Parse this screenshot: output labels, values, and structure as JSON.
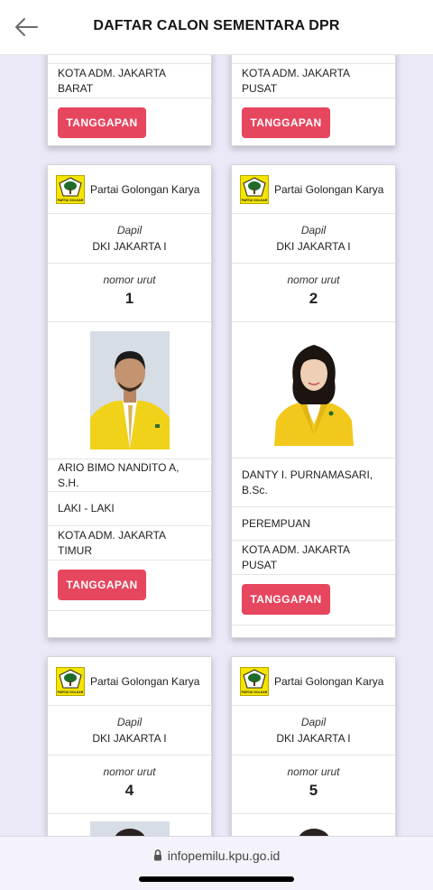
{
  "header": {
    "title": "DAFTAR CALON SEMENTARA DPR",
    "back_icon": "arrow-left-icon"
  },
  "top_partial_cards": [
    {
      "kota": "KOTA ADM. JAKARTA BARAT",
      "button": "TANGGAPAN"
    },
    {
      "kota": "KOTA ADM. JAKARTA PUSAT",
      "button": "TANGGAPAN"
    }
  ],
  "candidates": [
    {
      "party": "Partai Golongan Karya",
      "logo_text": "PARTAI GOLKAR",
      "dapil_label": "Dapil",
      "dapil": "DKI JAKARTA I",
      "nomor_label": "nomor urut",
      "nomor": "1",
      "name": "ARIO BIMO NANDITO A, S.H.",
      "gender": "LAKI - LAKI",
      "kota": "KOTA ADM. JAKARTA TIMUR",
      "button": "TANGGAPAN"
    },
    {
      "party": "Partai Golongan Karya",
      "logo_text": "PARTAI GOLKAR",
      "dapil_label": "Dapil",
      "dapil": "DKI JAKARTA I",
      "nomor_label": "nomor urut",
      "nomor": "2",
      "name": "DANTY I. PURNAMASARI, B.Sc.",
      "gender": "PEREMPUAN",
      "kota": "KOTA ADM. JAKARTA PUSAT",
      "button": "TANGGAPAN"
    },
    {
      "party": "Partai Golongan Karya",
      "logo_text": "PARTAI GOLKAR",
      "dapil_label": "Dapil",
      "dapil": "DKI JAKARTA I",
      "nomor_label": "nomor urut",
      "nomor": "4"
    },
    {
      "party": "Partai Golongan Karya",
      "logo_text": "PARTAI GOLKAR",
      "dapil_label": "Dapil",
      "dapil": "DKI JAKARTA I",
      "nomor_label": "nomor urut",
      "nomor": "5"
    }
  ],
  "footer": {
    "url": "infopemilu.kpu.go.id",
    "lock_icon": "lock-icon"
  },
  "colors": {
    "accent_button": "#e6465e",
    "golkar_yellow": "#f5e400",
    "page_background": "#ebe9f7"
  }
}
